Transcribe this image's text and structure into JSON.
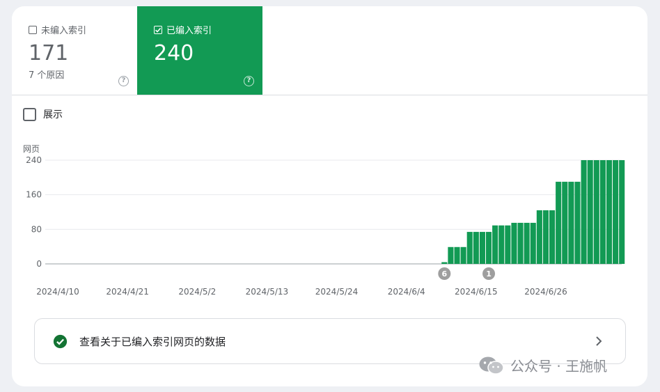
{
  "tiles": {
    "unindexed": {
      "label": "未编入索引",
      "count": "171",
      "sub": "7 个原因",
      "help": "?",
      "checked": false
    },
    "indexed": {
      "label": "已编入索引",
      "count": "240",
      "help": "?",
      "checked": true,
      "color": "#129a54"
    }
  },
  "show_toggle": {
    "label": "展示",
    "checked": false
  },
  "chart_data": {
    "type": "bar",
    "ylabel": "网页",
    "yticks": [
      0,
      80,
      160,
      240
    ],
    "ylim": [
      0,
      240
    ],
    "bar_color": "#129a54",
    "x_tick_labels": [
      "2024/4/10",
      "2024/4/21",
      "2024/5/2",
      "2024/5/13",
      "2024/5/24",
      "2024/6/4",
      "2024/6/15",
      "2024/6/26"
    ],
    "x": [
      "2024/4/10",
      "2024/4/11",
      "2024/4/12",
      "2024/4/13",
      "2024/4/14",
      "2024/4/15",
      "2024/4/16",
      "2024/4/17",
      "2024/4/18",
      "2024/4/19",
      "2024/4/20",
      "2024/4/21",
      "2024/4/22",
      "2024/4/23",
      "2024/4/24",
      "2024/4/25",
      "2024/4/26",
      "2024/4/27",
      "2024/4/28",
      "2024/4/29",
      "2024/4/30",
      "2024/5/1",
      "2024/5/2",
      "2024/5/3",
      "2024/5/4",
      "2024/5/5",
      "2024/5/6",
      "2024/5/7",
      "2024/5/8",
      "2024/5/9",
      "2024/5/10",
      "2024/5/11",
      "2024/5/12",
      "2024/5/13",
      "2024/5/14",
      "2024/5/15",
      "2024/5/16",
      "2024/5/17",
      "2024/5/18",
      "2024/5/19",
      "2024/5/20",
      "2024/5/21",
      "2024/5/22",
      "2024/5/23",
      "2024/5/24",
      "2024/5/25",
      "2024/5/26",
      "2024/5/27",
      "2024/5/28",
      "2024/5/29",
      "2024/5/30",
      "2024/5/31",
      "2024/6/1",
      "2024/6/2",
      "2024/6/3",
      "2024/6/4",
      "2024/6/5",
      "2024/6/6",
      "2024/6/7",
      "2024/6/8",
      "2024/6/9",
      "2024/6/10",
      "2024/6/11",
      "2024/6/12",
      "2024/6/13",
      "2024/6/14",
      "2024/6/15",
      "2024/6/16",
      "2024/6/17",
      "2024/6/18",
      "2024/6/19",
      "2024/6/20",
      "2024/6/21",
      "2024/6/22",
      "2024/6/23",
      "2024/6/24",
      "2024/6/25",
      "2024/6/26",
      "2024/6/27",
      "2024/6/28",
      "2024/6/29",
      "2024/6/30",
      "2024/7/1",
      "2024/7/2",
      "2024/7/3",
      "2024/7/4",
      "2024/7/5",
      "2024/7/6"
    ],
    "values": [
      0,
      0,
      0,
      0,
      0,
      0,
      0,
      0,
      0,
      0,
      0,
      0,
      0,
      0,
      0,
      0,
      0,
      0,
      0,
      0,
      0,
      0,
      0,
      0,
      0,
      0,
      0,
      0,
      0,
      0,
      0,
      0,
      0,
      0,
      0,
      0,
      0,
      0,
      0,
      0,
      0,
      0,
      0,
      0,
      0,
      0,
      0,
      0,
      0,
      0,
      0,
      0,
      0,
      0,
      0,
      0,
      0,
      0,
      0,
      0,
      0,
      4,
      39,
      39,
      39,
      74,
      74,
      74,
      74,
      89,
      89,
      89,
      95,
      95,
      95,
      95,
      124,
      124,
      124,
      190,
      190,
      190,
      190,
      240,
      240,
      240,
      240,
      240,
      240,
      240
    ],
    "annotations": [
      {
        "label": "6",
        "x": "2024/6/10"
      },
      {
        "label": "1",
        "x": "2024/6/17"
      }
    ]
  },
  "link_card": {
    "text": "查看关于已编入索引网页的数据",
    "icon": "check-circle-icon",
    "icon_color": "#137333",
    "chevron": "chevron-right-icon"
  },
  "watermark": {
    "text": "公众号 · 王施帆",
    "icon": "wechat-icon"
  }
}
